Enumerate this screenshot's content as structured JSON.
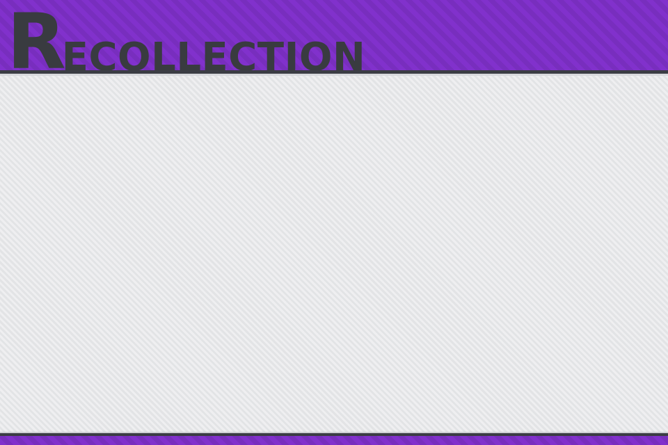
{
  "header": {
    "title_initial": "R",
    "title_rest": "ECOLLECTION"
  },
  "colors": {
    "accent_purple": "#8131cc",
    "title_dark": "#393b40",
    "content_background": "#e6e7e9",
    "rule_dark": "#3b3d44"
  }
}
